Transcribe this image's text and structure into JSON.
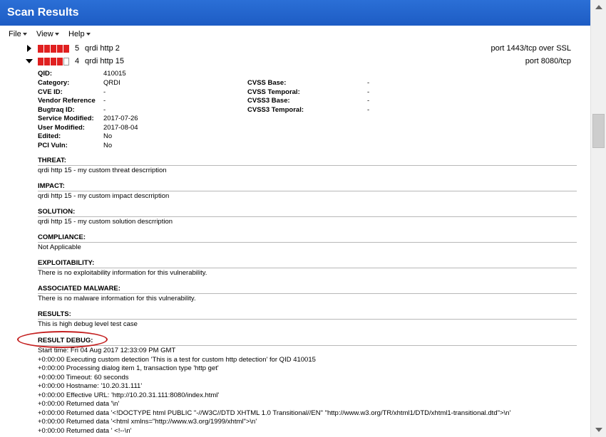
{
  "window": {
    "title": "Scan Results"
  },
  "menu": {
    "file": "File",
    "view": "View",
    "help": "Help"
  },
  "vulns": [
    {
      "severity": "5",
      "name": "qrdi http 2",
      "port": "port 1443/tcp over SSL",
      "filled": 5,
      "expanded": false
    },
    {
      "severity": "4",
      "name": "qrdi http 15",
      "port": "port 8080/tcp",
      "filled": 4,
      "expanded": true
    }
  ],
  "details_left": [
    {
      "key": "QID:",
      "value": "410015"
    },
    {
      "key": "Category:",
      "value": "QRDI"
    },
    {
      "key": "CVE ID:",
      "value": "-"
    },
    {
      "key": "Vendor Reference",
      "value": "-"
    },
    {
      "key": "Bugtraq ID:",
      "value": "-"
    },
    {
      "key": "Service Modified:",
      "value": "2017-07-26"
    },
    {
      "key": "User Modified:",
      "value": "2017-08-04"
    },
    {
      "key": "Edited:",
      "value": "No"
    },
    {
      "key": "PCI Vuln:",
      "value": "No"
    }
  ],
  "details_right": [
    {
      "key": "CVSS Base:",
      "value": "-"
    },
    {
      "key": "CVSS Temporal:",
      "value": "-"
    },
    {
      "key": "CVSS3 Base:",
      "value": "-"
    },
    {
      "key": "CVSS3 Temporal:",
      "value": "-"
    }
  ],
  "sections": [
    {
      "heading": "THREAT:",
      "body": "qrdi http 15 - my custom threat descrription"
    },
    {
      "heading": "IMPACT:",
      "body": "qrdi http 15 - my custom impact descrription"
    },
    {
      "heading": "SOLUTION:",
      "body": "qrdi http 15 - my custom solution descrription"
    },
    {
      "heading": "COMPLIANCE:",
      "body": "Not Applicable"
    },
    {
      "heading": "EXPLOITABILITY:",
      "body": "There is no exploitability information for this vulnerability."
    },
    {
      "heading": "ASSOCIATED MALWARE:",
      "body": "There is no malware information for this vulnerability."
    },
    {
      "heading": "RESULTS:",
      "body": "This is high debug level test case"
    },
    {
      "heading": "RESULT DEBUG:",
      "body": ""
    }
  ],
  "debug_lines": [
    "Start time: Fri 04 Aug 2017 12:33:09 PM GMT",
    "+0:00:00 Executing custom detection 'This is a test for custom http detection' for QID 410015",
    "+0:00:00 Processing dialog item 1, transaction type 'http get'",
    "+0:00:00 Timeout: 60 seconds",
    "+0:00:00 Hostname: '10.20.31.111'",
    "+0:00:00 Effective URL: 'http://10.20.31.111:8080/index.html'",
    "+0:00:00 Returned data '\\n'",
    "+0:00:00 Returned data '<!DOCTYPE html PUBLIC \"-//W3C//DTD XHTML 1.0 Transitional//EN\" \"http://www.w3.org/TR/xhtml1/DTD/xhtml1-transitional.dtd\">\\n'",
    "+0:00:00 Returned data '<html xmlns=\"http://www.w3.org/1999/xhtml\">\\n'",
    "+0:00:00 Returned data ' <!--\\n'"
  ]
}
